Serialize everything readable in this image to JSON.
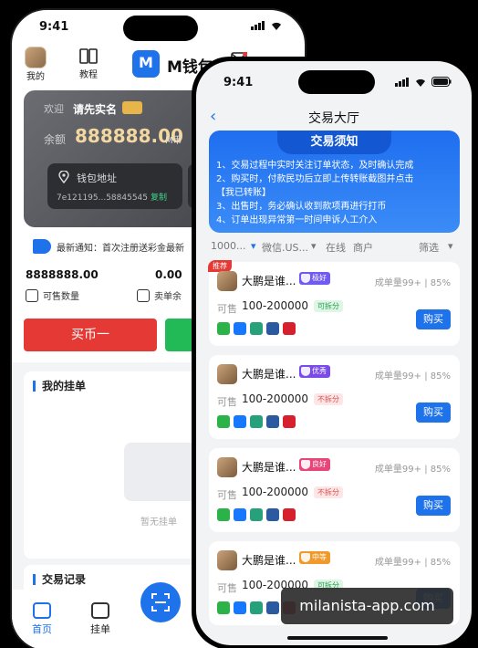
{
  "back": {
    "status": {
      "time": "9:41"
    },
    "header": {
      "profile_label": "我的",
      "tutorial_label": "教程",
      "app_title": "M钱包",
      "logo_letter": "M"
    },
    "wallet": {
      "welcome": "欢迎",
      "realname_prompt": "请先实名",
      "badge": "",
      "balance_label": "余额",
      "balance": "888888.00",
      "unit": "M币",
      "address_title": "钱包地址",
      "address": "7e121195...58845545",
      "copy_label": "复制"
    },
    "notice_text": "最新通知：首次注册送彩金最新",
    "stats": [
      {
        "value": "8888888.00",
        "label": "可售数量"
      },
      {
        "value": "0.00",
        "label": "卖单余"
      }
    ],
    "buy_one_label": "买币一",
    "my_orders_title": "我的挂单",
    "empty_text": "暂无挂单",
    "records_title": "交易记录",
    "tabs": [
      {
        "label": "首页",
        "active": true
      },
      {
        "label": "挂单",
        "active": false
      }
    ]
  },
  "front": {
    "status": {
      "time": "9:41"
    },
    "title": "交易大厅",
    "notice": {
      "title": "交易须知",
      "lines": [
        "1、交易过程中实时关注订单状态，及时确认完成",
        "2、购买时，付款民功后立即上传转账截图并点击",
        "【我已转账】",
        "3、出售时，务必确认收到款项再进行打币",
        "4、订单出现异常第一时间申诉人工介入"
      ]
    },
    "filters": {
      "amount": "1000...",
      "method": "微信.US...",
      "online": "在线",
      "merchant": "商户",
      "filter": "筛选"
    },
    "recommend_tag": "推荐",
    "listings": [
      {
        "name": "大鹏是谁...",
        "level": "极好",
        "level_color": "#6f5bf2",
        "volume": "成单量99+",
        "rate": "85%",
        "available_label": "可售",
        "range": "100-200000",
        "split": "可拆分",
        "splittable": true,
        "buy_label": "购买"
      },
      {
        "name": "大鹏是谁...",
        "level": "优秀",
        "level_color": "#7a4be8",
        "volume": "成单量99+",
        "rate": "85%",
        "available_label": "可售",
        "range": "100-200000",
        "split": "不拆分",
        "splittable": false,
        "buy_label": "购买"
      },
      {
        "name": "大鹏是谁...",
        "level": "良好",
        "level_color": "#e8467a",
        "volume": "成单量99+",
        "rate": "85%",
        "available_label": "可售",
        "range": "100-200000",
        "split": "不拆分",
        "splittable": false,
        "buy_label": "购买"
      },
      {
        "name": "大鹏是谁...",
        "level": "中等",
        "level_color": "#ef9a2a",
        "volume": "成单量99+",
        "rate": "85%",
        "available_label": "可售",
        "range": "100-200000",
        "split": "可拆分",
        "splittable": true,
        "buy_label": "购买"
      }
    ]
  },
  "watermark": "milanista-app.com"
}
